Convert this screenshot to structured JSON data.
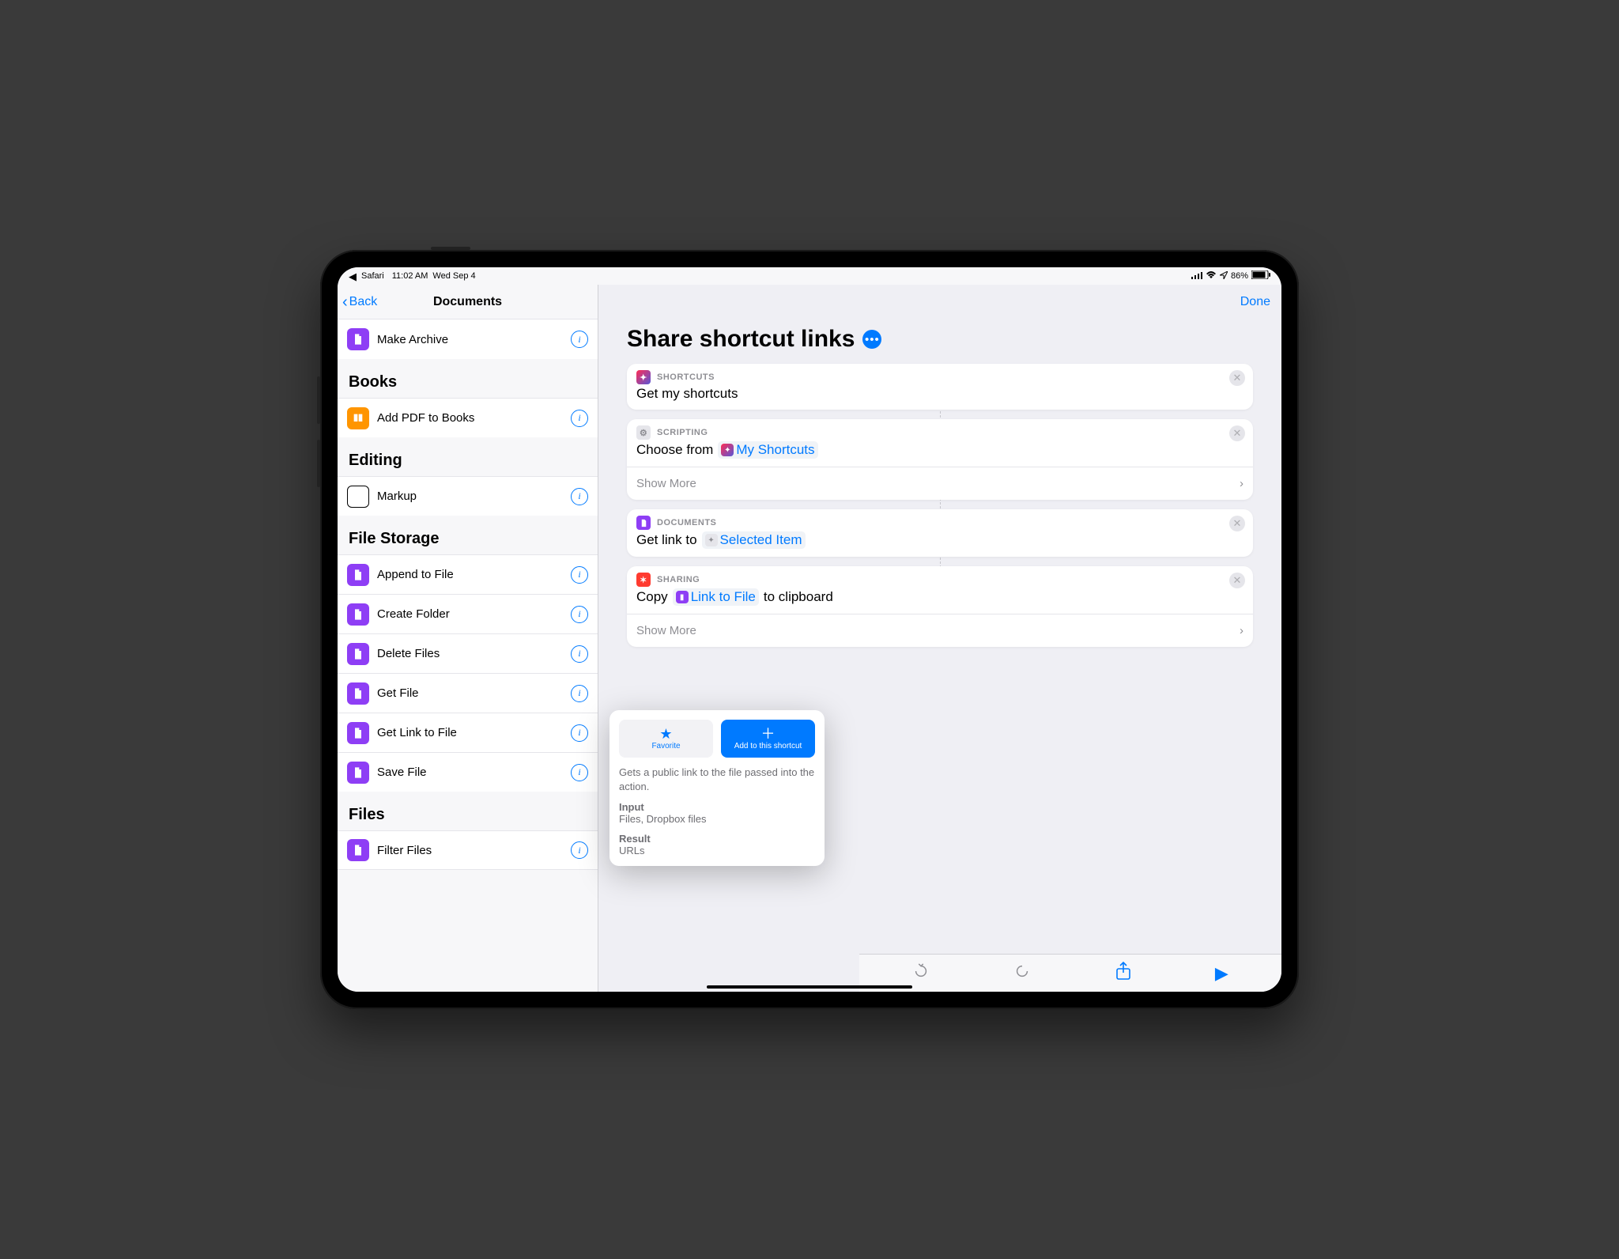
{
  "status": {
    "back_app": "Safari",
    "time": "11:02 AM",
    "date": "Wed Sep 4",
    "battery": "86%"
  },
  "sidebar": {
    "back_label": "Back",
    "title": "Documents",
    "top_item": "Make Archive",
    "sections": [
      {
        "title": "Books",
        "items": [
          {
            "label": "Add PDF to Books",
            "icon": "book",
            "color": "orange"
          }
        ]
      },
      {
        "title": "Editing",
        "items": [
          {
            "label": "Markup",
            "icon": "pen-circle",
            "color": "gray"
          }
        ]
      },
      {
        "title": "File Storage",
        "items": [
          {
            "label": "Append to File",
            "icon": "doc",
            "color": "purple"
          },
          {
            "label": "Create Folder",
            "icon": "doc",
            "color": "purple"
          },
          {
            "label": "Delete Files",
            "icon": "doc",
            "color": "purple"
          },
          {
            "label": "Get File",
            "icon": "doc",
            "color": "purple"
          },
          {
            "label": "Get Link to File",
            "icon": "doc",
            "color": "purple"
          },
          {
            "label": "Save File",
            "icon": "doc",
            "color": "purple"
          }
        ]
      },
      {
        "title": "Files",
        "items": [
          {
            "label": "Filter Files",
            "icon": "doc",
            "color": "purple"
          }
        ]
      }
    ]
  },
  "header": {
    "done": "Done",
    "title": "Share shortcut links"
  },
  "actions": [
    {
      "app": "SHORTCUTS",
      "app_icon": "shortcuts",
      "line_html": [
        {
          "t": "text",
          "v": "Get my shortcuts"
        }
      ],
      "show_more": null
    },
    {
      "app": "SCRIPTING",
      "app_icon": "scripting",
      "line_html": [
        {
          "t": "text",
          "v": "Choose from"
        },
        {
          "t": "token",
          "icon": "shortcuts",
          "v": "My Shortcuts"
        }
      ],
      "show_more": "Show More"
    },
    {
      "app": "DOCUMENTS",
      "app_icon": "doc",
      "line_html": [
        {
          "t": "text",
          "v": "Get link to"
        },
        {
          "t": "token",
          "icon": "scripting",
          "v": "Selected Item"
        }
      ],
      "show_more": null
    },
    {
      "app": "SHARING",
      "app_icon": "sharing",
      "line_html": [
        {
          "t": "text",
          "v": "Copy"
        },
        {
          "t": "token",
          "icon": "doc",
          "v": "Link to File"
        },
        {
          "t": "text",
          "v": "to clipboard"
        }
      ],
      "show_more": "Show More"
    }
  ],
  "popover": {
    "favorite": "Favorite",
    "add": "Add to this shortcut",
    "description": "Gets a public link to the file passed into the action.",
    "input_label": "Input",
    "input_value": "Files, Dropbox files",
    "result_label": "Result",
    "result_value": "URLs"
  }
}
